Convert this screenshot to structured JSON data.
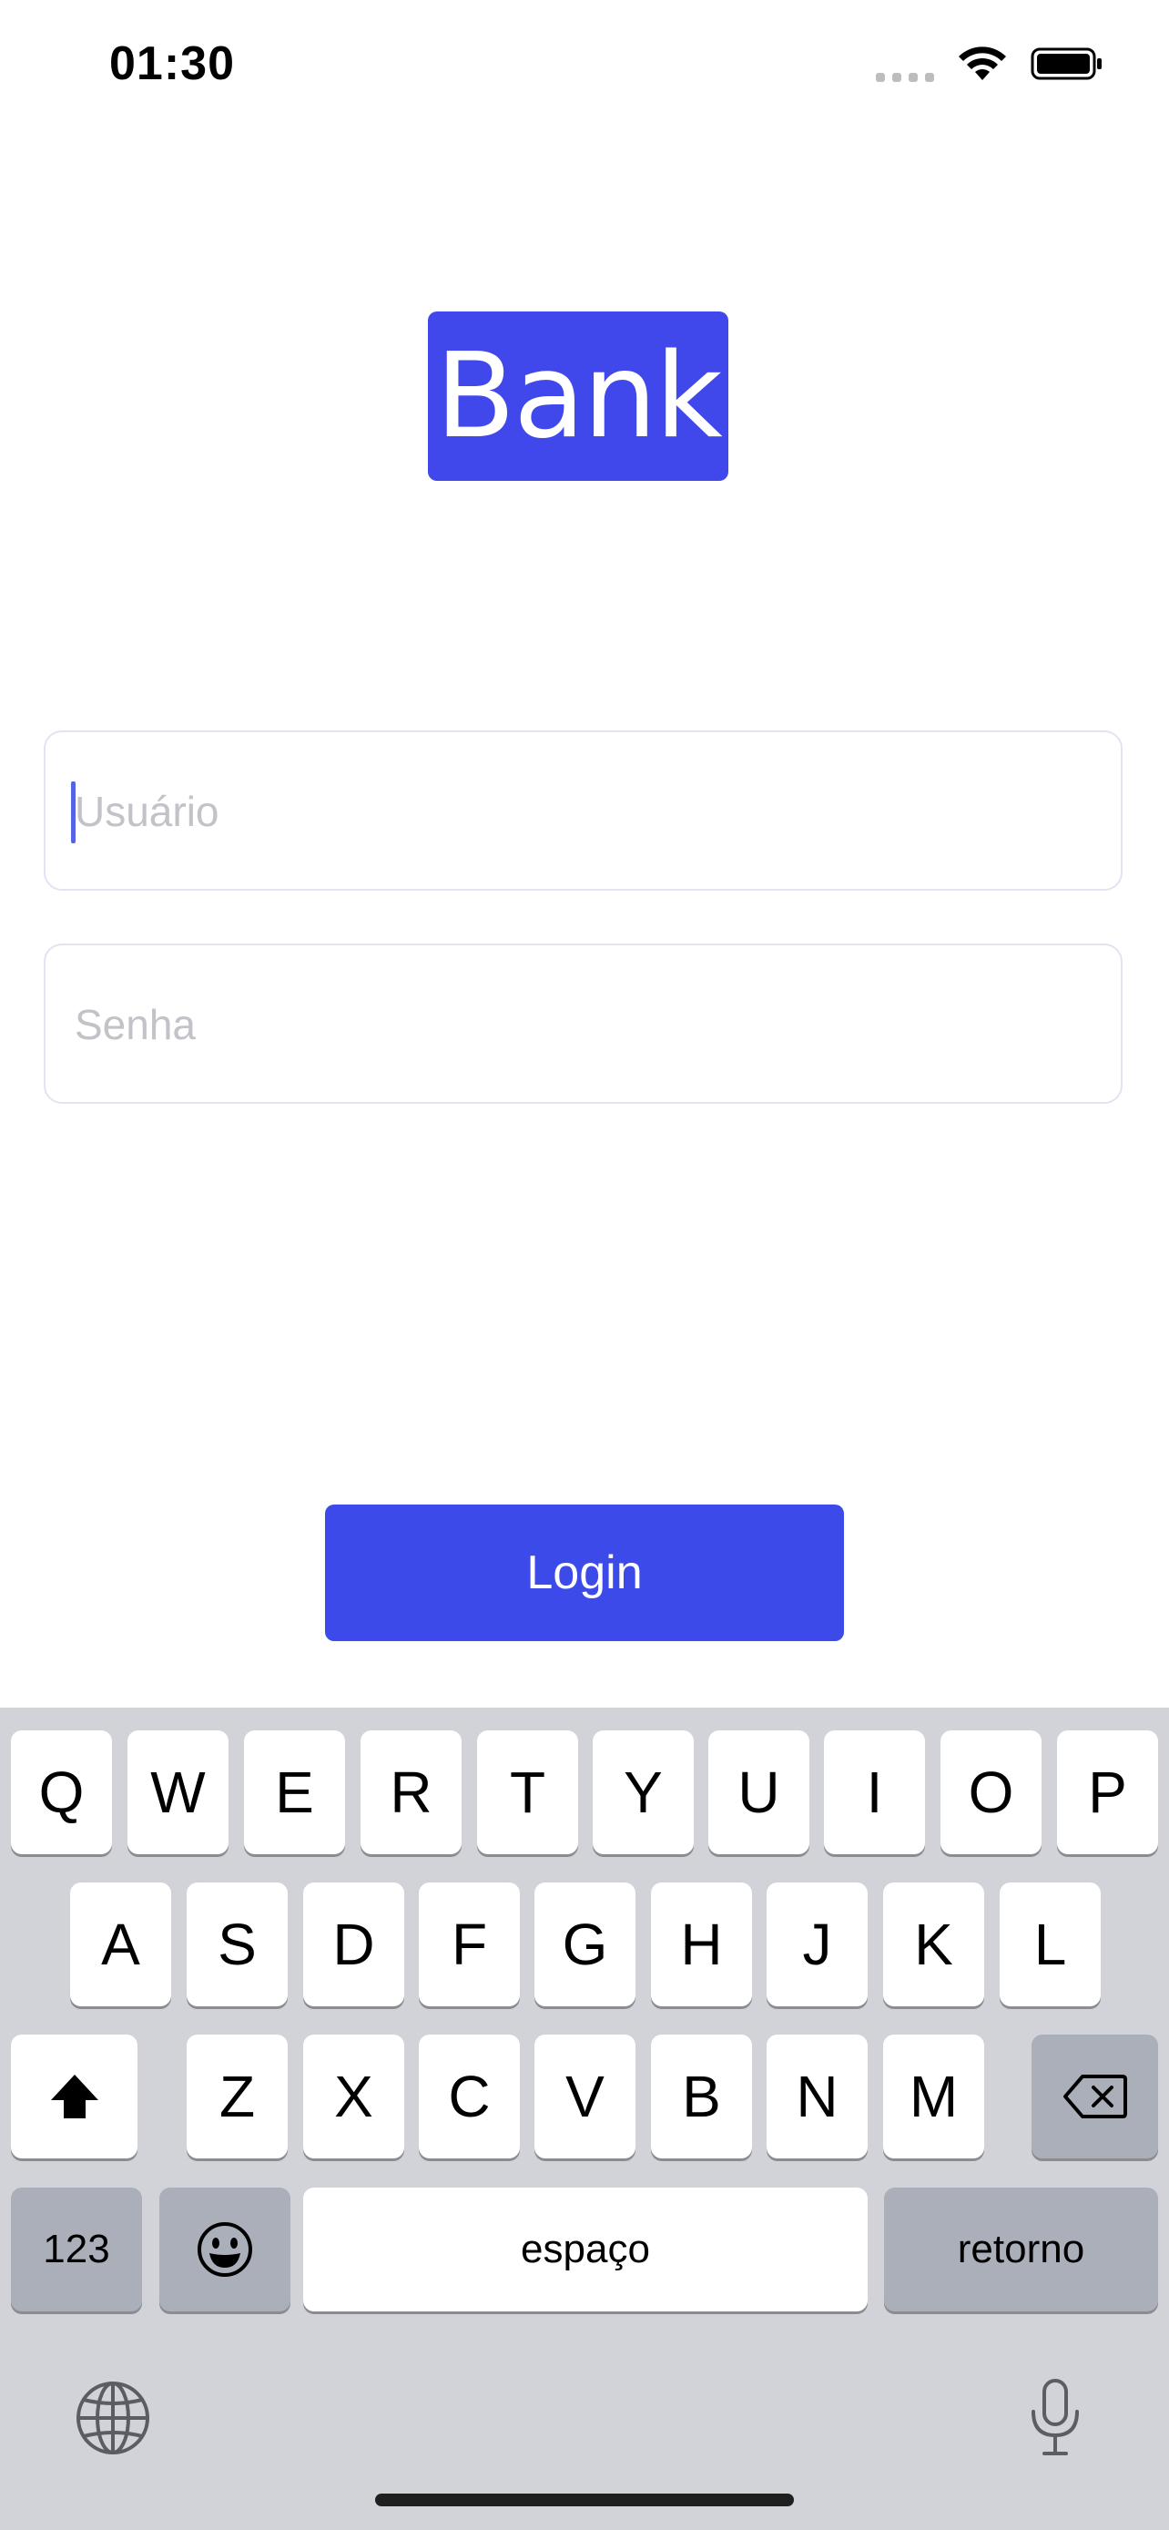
{
  "status_bar": {
    "time": "01:30",
    "icons": [
      "signal-icon",
      "wifi-icon",
      "battery-icon"
    ]
  },
  "logo": {
    "text": "Bank",
    "color": "#4048ec"
  },
  "form": {
    "username_placeholder": "Usuário",
    "username_value": "",
    "password_placeholder": "Senha",
    "password_value": ""
  },
  "login_button": {
    "label": "Login",
    "color": "#3d4aea"
  },
  "keyboard": {
    "row1": [
      "Q",
      "W",
      "E",
      "R",
      "T",
      "Y",
      "U",
      "I",
      "O",
      "P"
    ],
    "row2": [
      "A",
      "S",
      "D",
      "F",
      "G",
      "H",
      "J",
      "K",
      "L"
    ],
    "row3": [
      "Z",
      "X",
      "C",
      "V",
      "B",
      "N",
      "M"
    ],
    "numbers_label": "123",
    "space_label": "espaço",
    "return_label": "retorno",
    "icons": [
      "shift-icon",
      "backspace-icon",
      "emoji-icon",
      "globe-icon",
      "microphone-icon"
    ]
  }
}
